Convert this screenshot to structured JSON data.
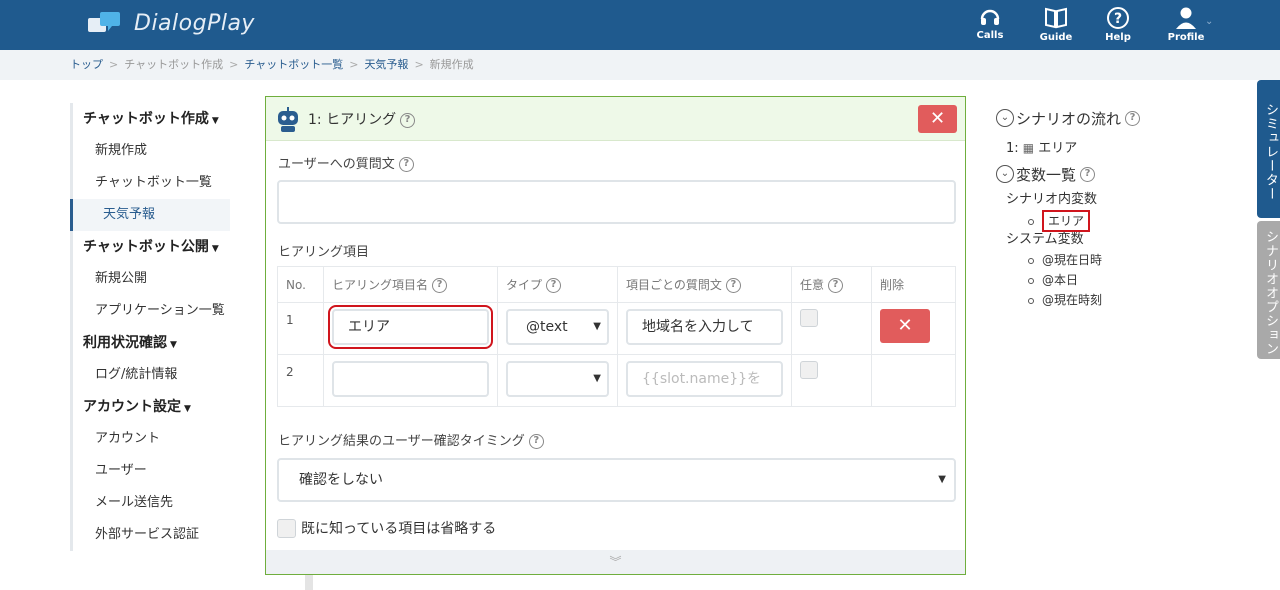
{
  "app": {
    "title": "DialogPlay"
  },
  "colors": {
    "topbar": "#1f5a8e",
    "accent_green": "#6fae3d",
    "danger": "#e15c5c",
    "highlight": "#d0151d"
  },
  "nav": [
    {
      "label": "Calls",
      "icon": "headset-icon"
    },
    {
      "label": "Guide",
      "icon": "book-icon"
    },
    {
      "label": "Help",
      "icon": "help-icon"
    },
    {
      "label": "Profile",
      "icon": "user-icon"
    }
  ],
  "breadcrumb": [
    "トップ",
    "チャットボット作成",
    "チャットボット一覧",
    "天気予報",
    "新規作成"
  ],
  "sidebar": [
    {
      "heading": "チャットボット作成",
      "items": [
        "新規作成",
        "チャットボット一覧",
        "天気予報"
      ]
    },
    {
      "heading": "チャットボット公開",
      "items": [
        "新規公開",
        "アプリケーション一覧"
      ]
    },
    {
      "heading": "利用状況確認",
      "items": [
        "ログ/統計情報"
      ]
    },
    {
      "heading": "アカウント設定",
      "items": [
        "アカウント",
        "ユーザー",
        "メール送信先",
        "外部サービス認証"
      ]
    }
  ],
  "panel": {
    "title": "1: ヒアリング",
    "question_label": "ユーザーへの質問文",
    "question_value": "",
    "items_label": "ヒアリング項目",
    "table": {
      "headers": [
        "No.",
        "ヒアリング項目名",
        "タイプ",
        "項目ごとの質問文",
        "任意",
        "削除"
      ],
      "rows": [
        {
          "no": "1",
          "name": "エリア",
          "type": "@text",
          "question": "地域名を入力して",
          "optional": false
        },
        {
          "no": "2",
          "name": "",
          "type": "",
          "question_placeholder": "{{slot.name}}を",
          "optional": false
        }
      ]
    },
    "confirm_label": "ヒアリング結果のユーザー確認タイミング",
    "confirm_value": "確認をしない",
    "skip_label": "既に知っている項目は省略する"
  },
  "right_panel": {
    "flow_title": "シナリオの流れ",
    "flow_items": [
      "1: ",
      "エリア"
    ],
    "vars_title": "変数一覧",
    "scenario_vars_label": "シナリオ内変数",
    "scenario_vars": [
      "エリア"
    ],
    "system_vars_label": "システム変数",
    "system_vars": [
      "@現在日時",
      "@本日",
      "@現在時刻"
    ]
  },
  "tabs": [
    "シミュレーター",
    "シナリオオプション"
  ]
}
